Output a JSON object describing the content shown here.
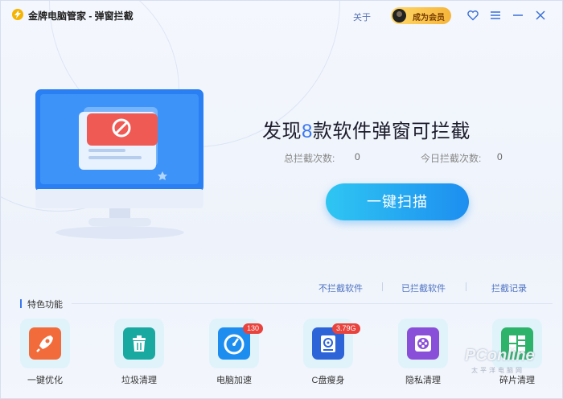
{
  "window": {
    "title": "金牌电脑管家 - 弹窗拦截"
  },
  "titlebar": {
    "about_label": "关于",
    "member_label": "成为会员"
  },
  "hero": {
    "headline_prefix": "发现",
    "headline_count": "8",
    "headline_suffix": "款软件弹窗可拦截",
    "total_label": "总拦截次数:",
    "total_value": "0",
    "today_label": "今日拦截次数:",
    "today_value": "0",
    "scan_button": "一键扫描"
  },
  "links": {
    "not_blocked": "不拦截软件",
    "blocked": "已拦截软件",
    "records": "拦截记录"
  },
  "features": {
    "title": "特色功能",
    "items": [
      {
        "label": "一键优化",
        "icon": "rocket-icon",
        "color": "#f26b3a",
        "badge": ""
      },
      {
        "label": "垃圾清理",
        "icon": "trash-icon",
        "color": "#1aa9a1",
        "badge": ""
      },
      {
        "label": "电脑加速",
        "icon": "speedometer-icon",
        "color": "#1d8ef0",
        "badge": "130"
      },
      {
        "label": "C盘瘦身",
        "icon": "disk-icon",
        "color": "#2d64d8",
        "badge": "3.79G"
      },
      {
        "label": "隐私清理",
        "icon": "film-reel-icon",
        "color": "#8a4fd8",
        "badge": ""
      },
      {
        "label": "碎片清理",
        "icon": "fragment-icon",
        "color": "#2eb36a",
        "badge": ""
      }
    ]
  },
  "watermark": {
    "brand": "PConline",
    "sub": "太平洋电脑网"
  }
}
